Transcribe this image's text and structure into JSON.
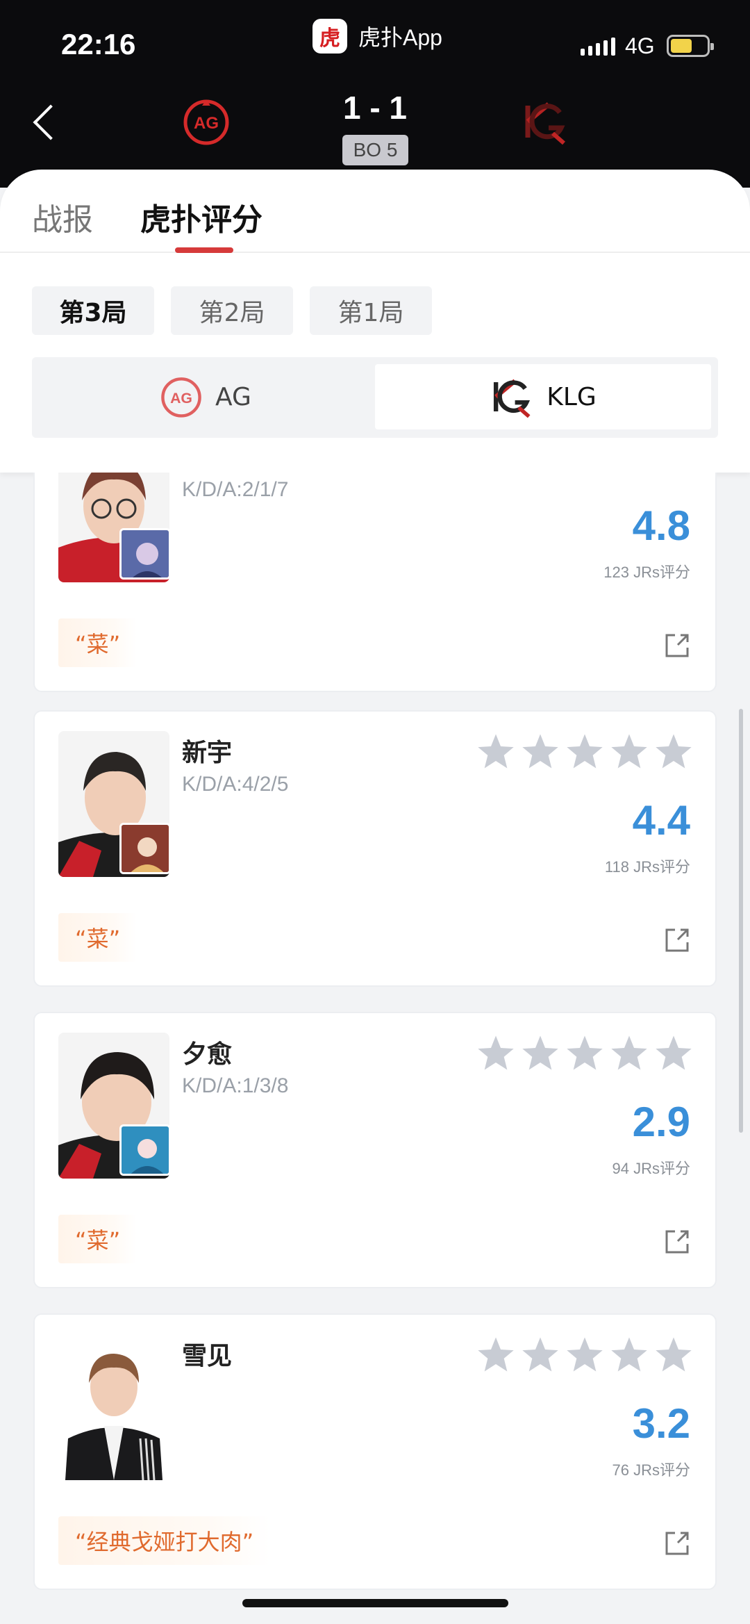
{
  "status_bar": {
    "time": "22:16",
    "app_name": "虎扑App",
    "app_logo_text": "虎扑",
    "network": "4G",
    "battery_color": "#f2d34a"
  },
  "match": {
    "score": "1 - 1",
    "format": "BO 5",
    "home_team": "AG",
    "away_team": "KLG"
  },
  "tabs": [
    {
      "label": "战报"
    },
    {
      "label": "虎扑评分"
    }
  ],
  "rounds": [
    {
      "label": "第3局"
    },
    {
      "label": "第2局"
    },
    {
      "label": "第1局"
    }
  ],
  "teams": {
    "left": "AG",
    "right": "KLG"
  },
  "players": [
    {
      "name": "",
      "kda": "K/D/A:2/1/7",
      "rating": "4.8",
      "votes": "123 JRs评分",
      "comment": "“菜”"
    },
    {
      "name": "新宇",
      "kda": "K/D/A:4/2/5",
      "rating": "4.4",
      "votes": "118 JRs评分",
      "comment": "“菜”"
    },
    {
      "name": "夕愈",
      "kda": "K/D/A:1/3/8",
      "rating": "2.9",
      "votes": "94 JRs评分",
      "comment": "“菜”"
    },
    {
      "name": "雪见",
      "kda": "",
      "rating": "3.2",
      "votes": "76 JRs评分",
      "comment": "“经典戈娅打大肉”"
    }
  ],
  "colors": {
    "accent": "#d63a3a",
    "rating": "#3a8fd9",
    "comment": "#e06a2e",
    "star": "#c8ccd4"
  }
}
